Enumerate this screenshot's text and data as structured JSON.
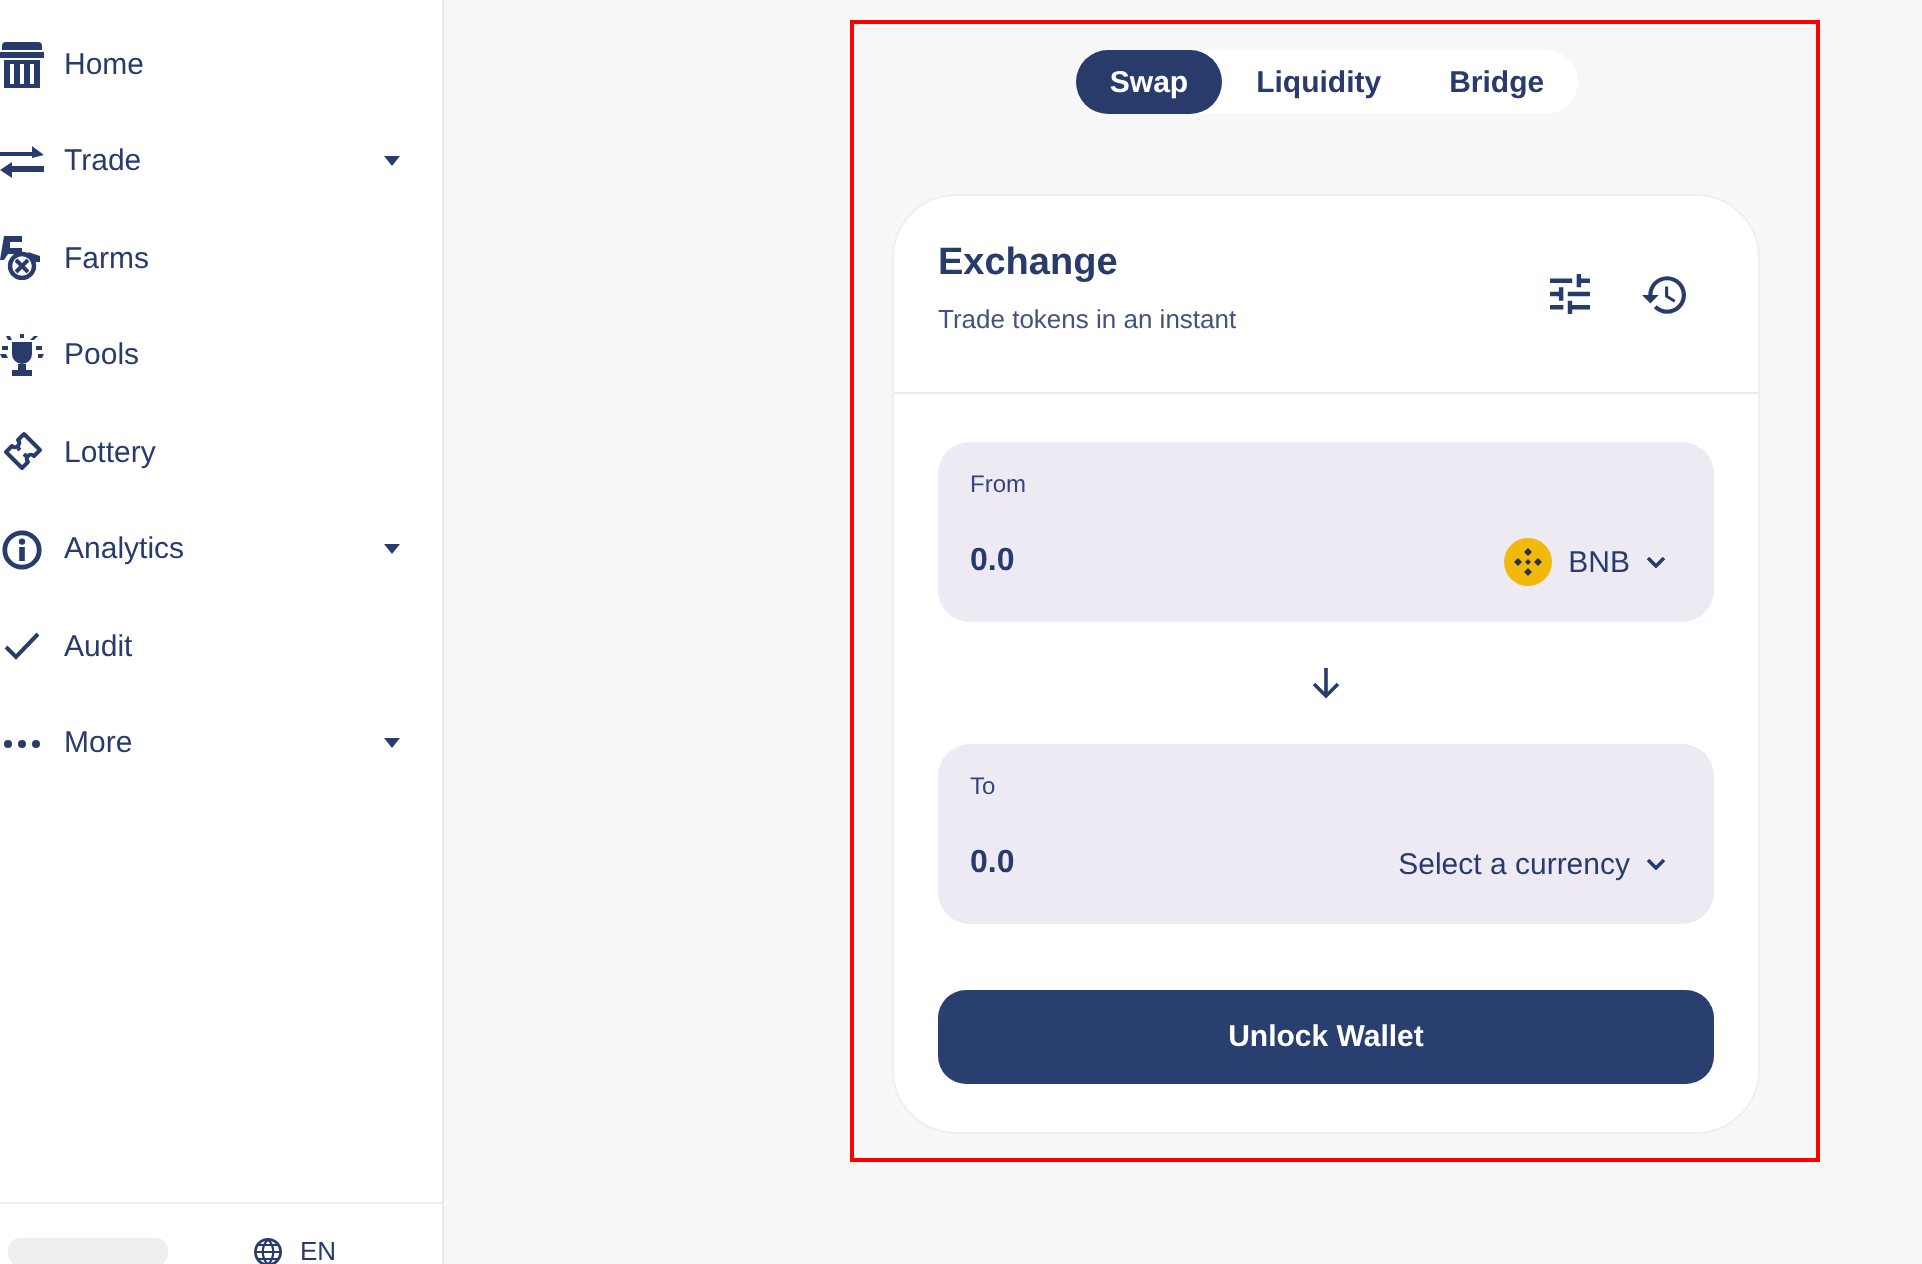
{
  "sidebar": {
    "items": [
      {
        "label": "Home",
        "expandable": false
      },
      {
        "label": "Trade",
        "expandable": true
      },
      {
        "label": "Farms",
        "expandable": false
      },
      {
        "label": "Pools",
        "expandable": false
      },
      {
        "label": "Lottery",
        "expandable": false
      },
      {
        "label": "Analytics",
        "expandable": true
      },
      {
        "label": "Audit",
        "expandable": false
      },
      {
        "label": "More",
        "expandable": true
      }
    ],
    "footer": {
      "language": "EN"
    }
  },
  "tabs": [
    {
      "label": "Swap",
      "selected": true
    },
    {
      "label": "Liquidity",
      "selected": false
    },
    {
      "label": "Bridge",
      "selected": false
    }
  ],
  "exchange": {
    "title": "Exchange",
    "subtitle": "Trade tokens in an instant",
    "fields": [
      {
        "label": "From",
        "placeholder": "0.0",
        "currency": {
          "kind": "token",
          "text": "BNB"
        }
      },
      {
        "label": "To",
        "placeholder": "0.0",
        "currency": {
          "kind": "prompt",
          "text": "Select a currency"
        }
      }
    ],
    "action": "Unlock Wallet"
  }
}
